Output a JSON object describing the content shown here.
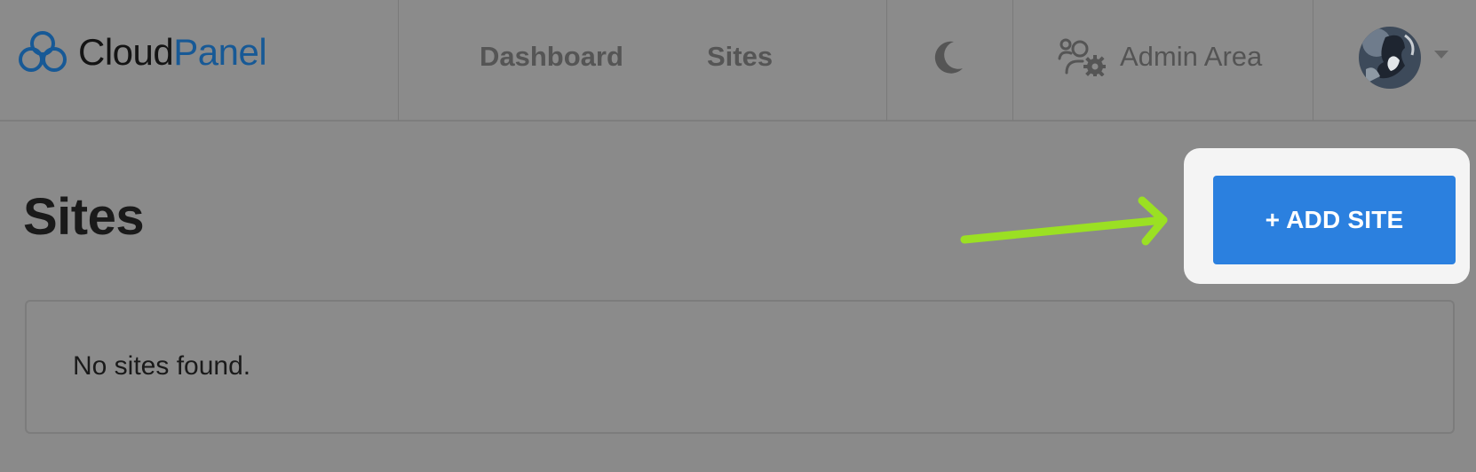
{
  "brand": {
    "name_part1": "Cloud",
    "name_part2": "Panel",
    "logo_icon": "cloud-logo-icon",
    "colors": {
      "accent": "#175996"
    }
  },
  "nav": {
    "links": [
      {
        "label": "Dashboard"
      },
      {
        "label": "Sites"
      }
    ],
    "theme_toggle_icon": "moon-icon",
    "admin": {
      "icon": "users-cog-icon",
      "label": "Admin Area"
    },
    "user": {
      "avatar_icon": "avatar-image",
      "menu_icon": "caret-down-icon"
    }
  },
  "main": {
    "title": "Sites",
    "add_button_label": "+ ADD SITE",
    "add_button_color": "#2b80df",
    "annotation_arrow_color": "#9be023",
    "empty_message": "No sites found."
  }
}
